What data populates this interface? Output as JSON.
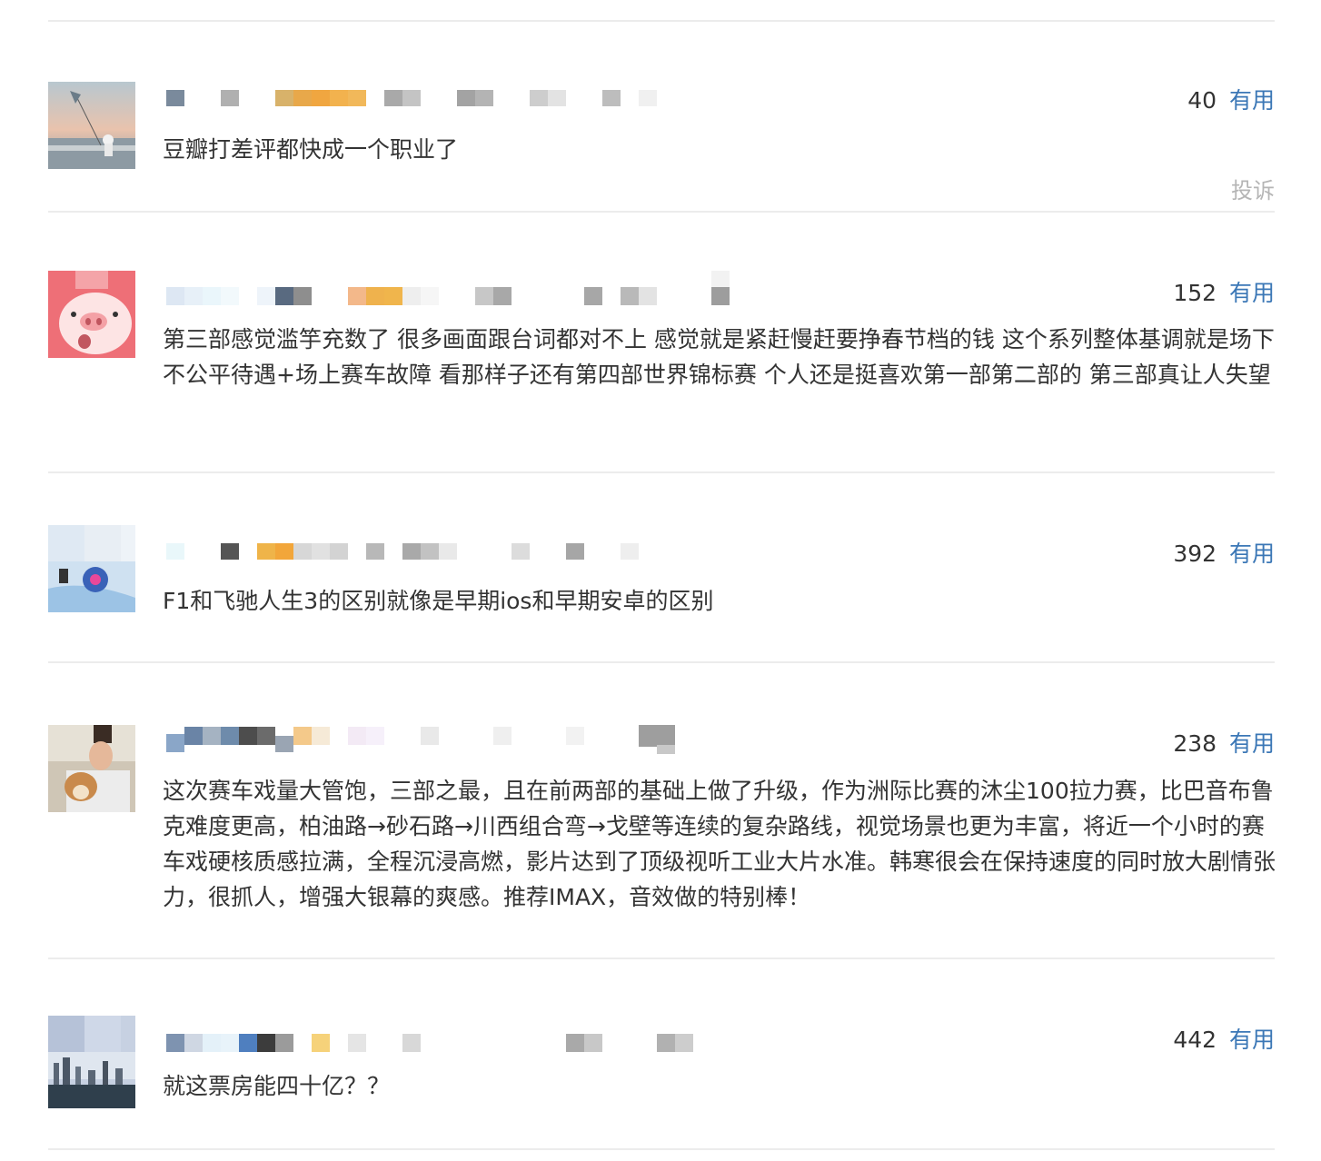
{
  "comments": [
    {
      "votes": "40",
      "useful_label": "有用",
      "text": "豆瓣打差评都快成一个职业了",
      "report_label": "投诉"
    },
    {
      "votes": "152",
      "useful_label": "有用",
      "text": "第三部感觉滥竽充数了 很多画面跟台词都对不上 感觉就是紧赶慢赶要挣春节档的钱 这个系列整体基调就是场下不公平待遇+场上赛车故障 看那样子还有第四部世界锦标赛 个人还是挺喜欢第一部第二部的 第三部真让人失望"
    },
    {
      "votes": "392",
      "useful_label": "有用",
      "text": "F1和飞驰人生3的区别就像是早期ios和早期安卓的区别"
    },
    {
      "votes": "238",
      "useful_label": "有用",
      "text": "这次赛车戏量大管饱，三部之最，且在前两部的基础上做了升级，作为洲际比赛的沐尘100拉力赛，比巴音布鲁克难度更高，柏油路→砂石路→川西组合弯→戈壁等连续的复杂路线，视觉场景也更为丰富，将近一个小时的赛车戏硬核质感拉满，全程沉浸高燃，影片达到了顶级视听工业大片水准。韩寒很会在保持速度的同时放大剧情张力，很抓人，增强大银幕的爽感。推荐IMAX，音效做的特别棒！"
    },
    {
      "votes": "442",
      "useful_label": "有用",
      "text": "就这票房能四十亿？？"
    }
  ],
  "colors": {
    "link": "#3b77b6",
    "text": "#333333",
    "muted": "#b5b5b5",
    "divider": "#ececec"
  }
}
